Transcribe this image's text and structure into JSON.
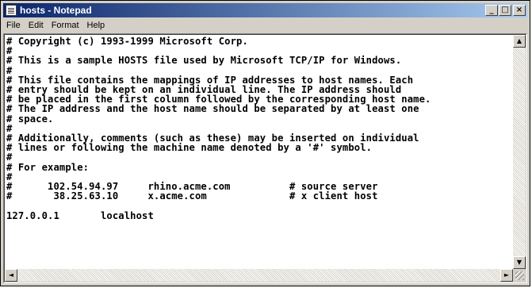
{
  "window": {
    "title": "hosts - Notepad",
    "icon": "notepad-icon",
    "controls": {
      "minimize": "_",
      "maximize": "□",
      "close": "×"
    }
  },
  "menu": {
    "items": [
      "File",
      "Edit",
      "Format",
      "Help"
    ]
  },
  "editor": {
    "content": "# Copyright (c) 1993-1999 Microsoft Corp.\n#\n# This is a sample HOSTS file used by Microsoft TCP/IP for Windows.\n#\n# This file contains the mappings of IP addresses to host names. Each\n# entry should be kept on an individual line. The IP address should\n# be placed in the first column followed by the corresponding host name.\n# The IP address and the host name should be separated by at least one\n# space.\n#\n# Additionally, comments (such as these) may be inserted on individual\n# lines or following the machine name denoted by a '#' symbol.\n#\n# For example:\n#\n#      102.54.94.97     rhino.acme.com          # source server\n#       38.25.63.10     x.acme.com              # x client host\n\n127.0.0.1       localhost"
  },
  "scrollbars": {
    "up": "▲",
    "down": "▼",
    "left": "◄",
    "right": "►"
  }
}
